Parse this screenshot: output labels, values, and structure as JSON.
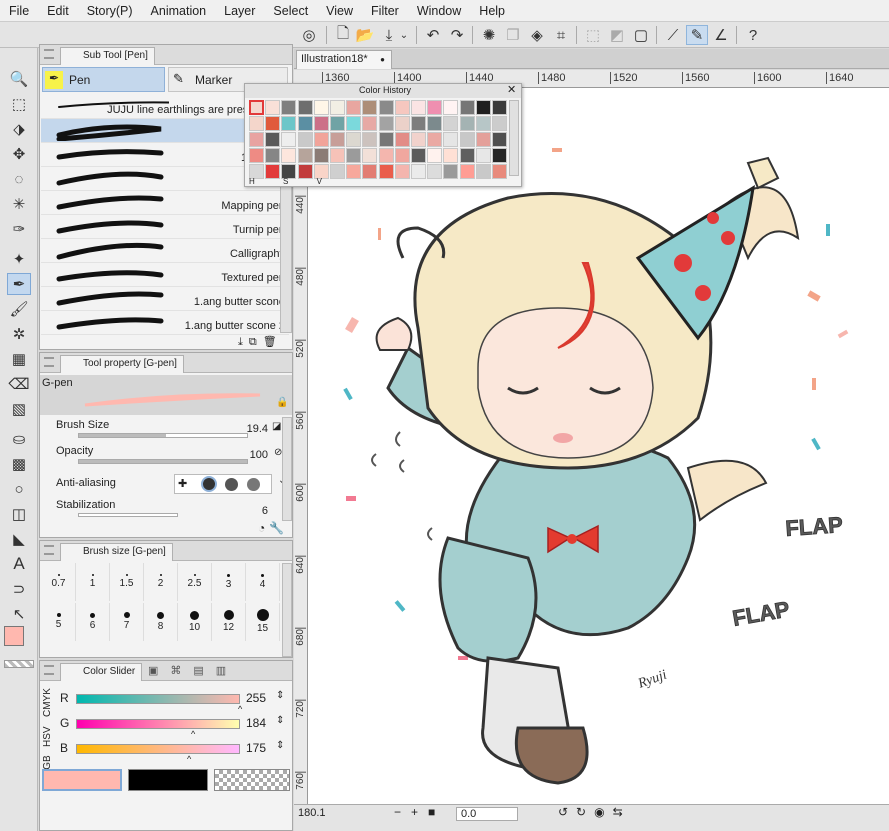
{
  "menu": [
    "File",
    "Edit",
    "Story(P)",
    "Animation",
    "Layer",
    "Select",
    "View",
    "Filter",
    "Window",
    "Help"
  ],
  "canvas_tab": {
    "title": "Illustration18*",
    "modified_dot": "●"
  },
  "ruler_top": [
    "1360",
    "1400",
    "1440",
    "1480",
    "1520",
    "1560",
    "1600",
    "1640"
  ],
  "ruler_left": [
    "440",
    "480",
    "520",
    "560",
    "600",
    "640",
    "680",
    "720",
    "760"
  ],
  "subtool": {
    "tab_label": "Sub Tool [Pen]",
    "groups": [
      {
        "label": "Pen"
      },
      {
        "label": "Marker"
      }
    ],
    "brushes": [
      {
        "label": "JUJU line earthlings are pressure-se"
      },
      {
        "label": ""
      },
      {
        "label": "10.milk p"
      },
      {
        "label": "Rea"
      },
      {
        "label": "Mapping pen"
      },
      {
        "label": "Turnip pen"
      },
      {
        "label": "Calligraphy"
      },
      {
        "label": "Textured pen"
      },
      {
        "label": "1.ang butter scone"
      },
      {
        "label": "1.ang butter scone 2"
      }
    ]
  },
  "color_history": {
    "title": "Color History",
    "swatches": [
      "#f4d8cf",
      "#f9e0d8",
      "#7f7f7f",
      "#6e6e6e",
      "#fff6e8",
      "#f2efe4",
      "#e8a6a0",
      "#ad8e78",
      "#8a8a8a",
      "#f6c7bf",
      "#fbe4e4",
      "#ef8fb0",
      "#fff3f3",
      "#767676",
      "#1f1f1f",
      "#3a3a3a",
      "#f4d6cb",
      "#e05a3c",
      "#6cc6c9",
      "#5b8fa3",
      "#cc7088",
      "#70a3a5",
      "#7bd9dc",
      "#e7a9a5",
      "#a3a3a3",
      "#ebd1c9",
      "#7d7d7d",
      "#7c8a8d",
      "#d3d3d3",
      "#a4b3b3",
      "#b7c6c7",
      "#cccccc",
      "#e8a3a1",
      "#5a5a5a",
      "#eeeeee",
      "#c9c9c9",
      "#f1a49a",
      "#c79e98",
      "#dcd8d0",
      "#ccc2be",
      "#777777",
      "#e28c87",
      "#f1d2cc",
      "#eaa9a3",
      "#e5e5e5",
      "#c8c8c8",
      "#e4a09a",
      "#505050",
      "#ee8b84",
      "#868686",
      "#fde6dd",
      "#b6a49b",
      "#8b7b75",
      "#f6c2b8",
      "#9b9b9b",
      "#f2e0d8",
      "#f4b6ae",
      "#f0a79f",
      "#5c5c5c",
      "#fff2ee",
      "#ffe0d5",
      "#5f5f5f",
      "#e7e7e7",
      "#252525",
      "#d8d8d8",
      "#e23a3a",
      "#444444",
      "#c23c3c",
      "#f9d4c8",
      "#cfcfcf",
      "#f7a89c",
      "#e27d73",
      "#ea5d4c",
      "#f4b5ae",
      "#ebebeb",
      "#dcdcdc",
      "#9a9a9a",
      "#ff9d94",
      "#c9c9c9",
      "#e88a7c"
    ],
    "footer": [
      "H",
      "S",
      "V"
    ]
  },
  "tool_property": {
    "tab_label": "Tool property [G-pen]",
    "preset": "G-pen",
    "brush_size": {
      "label": "Brush Size",
      "value": "19.4"
    },
    "opacity": {
      "label": "Opacity",
      "value": "100"
    },
    "anti_aliasing": {
      "label": "Anti-aliasing"
    },
    "stabilization": {
      "label": "Stabilization",
      "value": "6"
    }
  },
  "brush_size_panel": {
    "tab_label": "Brush size [G-pen]",
    "sizes_row1": [
      "0.7",
      "1",
      "1.5",
      "2",
      "2.5",
      "3",
      "4"
    ],
    "sizes_row2": [
      "5",
      "6",
      "7",
      "8",
      "10",
      "12",
      "15"
    ]
  },
  "color_slider": {
    "tab_label": "Color Slider",
    "modes": [
      "RGB",
      "HSV",
      "CMYK"
    ],
    "r": {
      "label": "R",
      "value": "255"
    },
    "g": {
      "label": "G",
      "value": "184"
    },
    "b": {
      "label": "B",
      "value": "175"
    },
    "main_color": "#ffb8af",
    "sub_color": "#000000"
  },
  "artwork": {
    "words": [
      "FLAP",
      "FLAP"
    ],
    "signature": "Ryuji"
  },
  "statusbar": {
    "zoom": "180.1",
    "angle": "0.0"
  }
}
